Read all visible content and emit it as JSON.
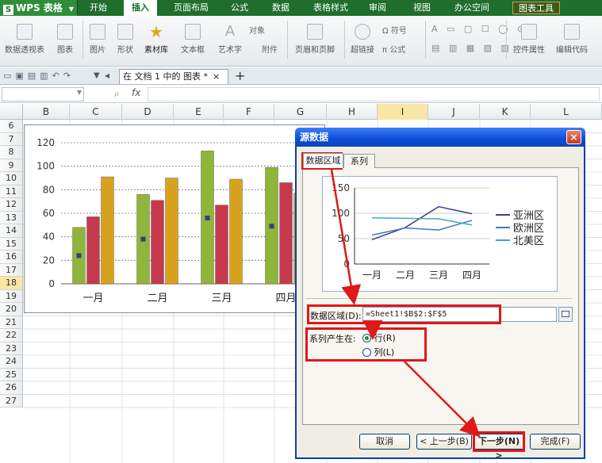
{
  "menubar": {
    "app": "WPS 表格",
    "items": [
      "开始",
      "插入",
      "页面布局",
      "公式",
      "数据",
      "表格样式",
      "审阅",
      "视图",
      "办公空间"
    ],
    "active_index": 1,
    "chart_tools": "图表工具"
  },
  "ribbon": {
    "buttons": [
      "数据透视表",
      "图表",
      "图片",
      "形状",
      "素材库",
      "文本框",
      "艺术字",
      "页眉和页脚",
      "超链接",
      "公式",
      "控件属性",
      "编辑代码"
    ],
    "small": [
      "对象",
      "附件",
      "符号"
    ]
  },
  "tabs": {
    "doc_title": "在 文档 1 中的 图表 *",
    "close": "×",
    "add": "+"
  },
  "formula_bar": {
    "fx": "fx"
  },
  "grid": {
    "columns": [
      "B",
      "C",
      "D",
      "E",
      "F",
      "G",
      "H",
      "I",
      "J",
      "K",
      "L"
    ],
    "rows": [
      "6",
      "7",
      "8",
      "9",
      "10",
      "11",
      "12",
      "13",
      "14",
      "15",
      "16",
      "17",
      "18",
      "19",
      "20",
      "21",
      "22",
      "23",
      "24",
      "25",
      "26",
      "27"
    ],
    "selected_row": "18"
  },
  "chart_data": [
    {
      "type": "bar",
      "categories": [
        "一月",
        "二月",
        "三月",
        "四月"
      ],
      "series": [
        {
          "values": [
            48,
            76,
            113,
            99
          ],
          "color": "#8db63a"
        },
        {
          "values": [
            57,
            71,
            67,
            86
          ],
          "color": "#c43a4c"
        },
        {
          "values": [
            91,
            90,
            89,
            77
          ],
          "color": "#d8a21e"
        }
      ],
      "ylim": [
        0,
        120
      ],
      "yticks": [
        0,
        20,
        40,
        60,
        80,
        100,
        120
      ],
      "markers": [
        24,
        38,
        56,
        49
      ],
      "grid": "dashed"
    },
    {
      "type": "line",
      "categories": [
        "一月",
        "二月",
        "三月",
        "四月"
      ],
      "series": [
        {
          "name": "亚洲区",
          "values": [
            48,
            72,
            113,
            99
          ],
          "color": "#3b3f8f"
        },
        {
          "name": "欧洲区",
          "values": [
            57,
            71,
            67,
            86
          ],
          "color": "#3b78c7"
        },
        {
          "name": "北美区",
          "values": [
            91,
            90,
            89,
            77
          ],
          "color": "#3aaeb6"
        }
      ],
      "ylim": [
        0,
        150
      ],
      "yticks": [
        0,
        50,
        100,
        150
      ],
      "legend": "right"
    }
  ],
  "dialog": {
    "title": "源数据",
    "close": "×",
    "tabs": [
      "数据区域",
      "系列"
    ],
    "range_label": "数据区域(D):",
    "range_value": "=Sheet1!$B$2:$F$5",
    "series_in_label": "系列产生在:",
    "rows_option": "行(R)",
    "cols_option": "列(L)",
    "buttons": {
      "cancel": "取消",
      "back": "< 上一步(B)",
      "next": "下一步(N) >",
      "finish": "完成(F)"
    }
  }
}
